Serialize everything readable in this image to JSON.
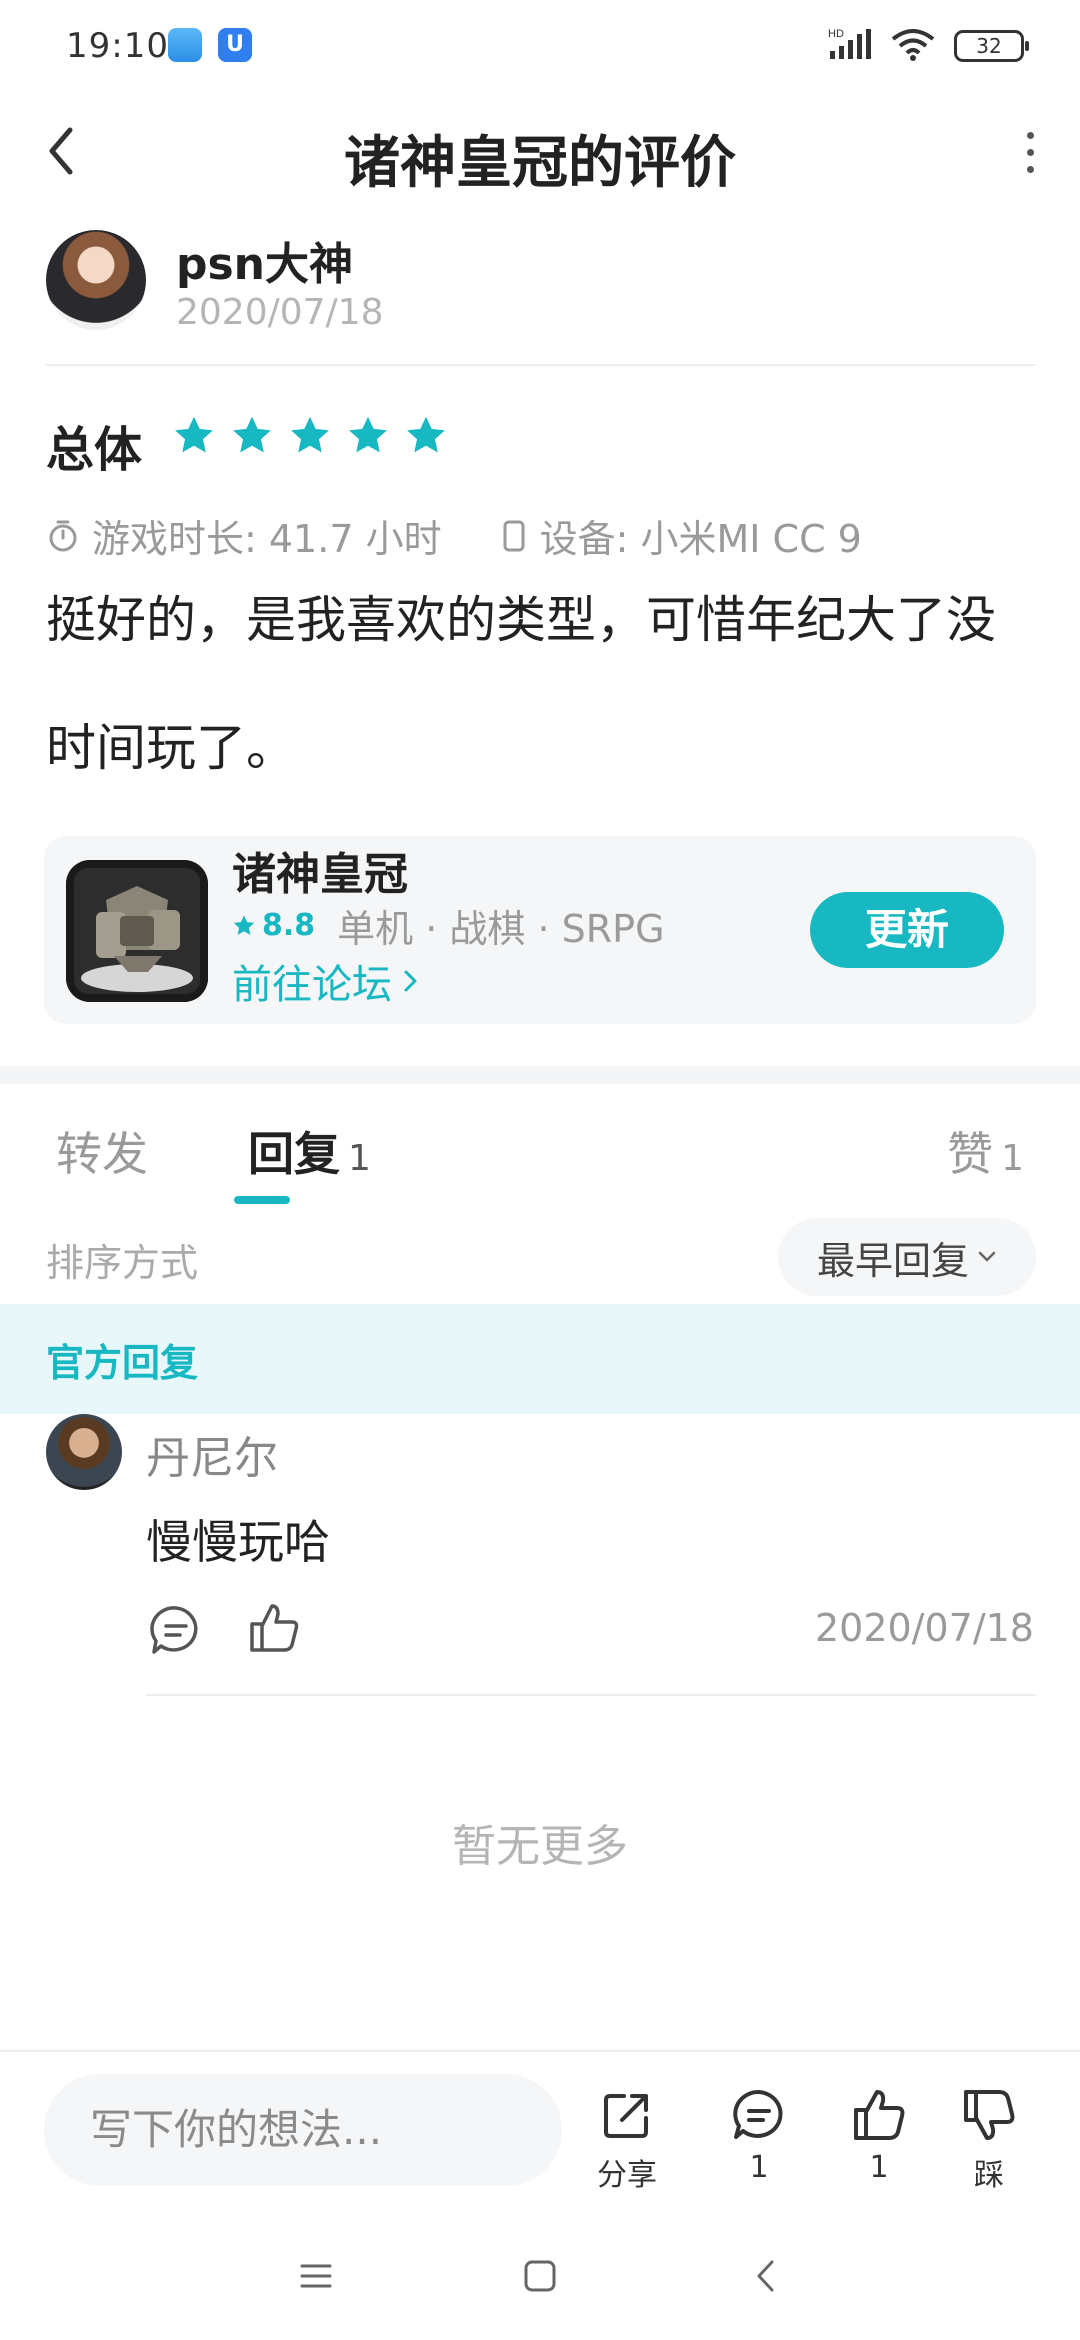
{
  "status_bar": {
    "time": "19:10",
    "battery": "32",
    "network": "HD"
  },
  "header": {
    "title": "诸神皇冠的评价"
  },
  "author": {
    "name": "psn大神",
    "date": "2020/07/18"
  },
  "review": {
    "overall_label": "总体",
    "stars": 5,
    "playtime": "游戏时长: 41.7 小时",
    "device": "设备: 小米MI CC 9",
    "text": "挺好的，是我喜欢的类型，可惜年纪大了没时间玩了。"
  },
  "game": {
    "name": "诸神皇冠",
    "rating": "8.8",
    "tags": "单机 · 战棋 · SRPG",
    "forum_link": "前往论坛",
    "update_button": "更新"
  },
  "tabs": {
    "forward": "转发",
    "reply": "回复",
    "reply_count": "1",
    "like": "赞",
    "like_count": "1"
  },
  "sort": {
    "label": "排序方式",
    "value": "最早回复"
  },
  "official": {
    "label": "官方回复"
  },
  "reply": {
    "name": "丹尼尔",
    "text": "慢慢玩哈",
    "date": "2020/07/18"
  },
  "footer": {
    "no_more": "暂无更多"
  },
  "bottom_bar": {
    "input_placeholder": "写下你的想法...",
    "share_label": "分享",
    "comment_count": "1",
    "like_count": "1",
    "dislike_label": "踩"
  },
  "colors": {
    "accent": "#17b8c2",
    "official_bg": "#e8f7fa"
  }
}
